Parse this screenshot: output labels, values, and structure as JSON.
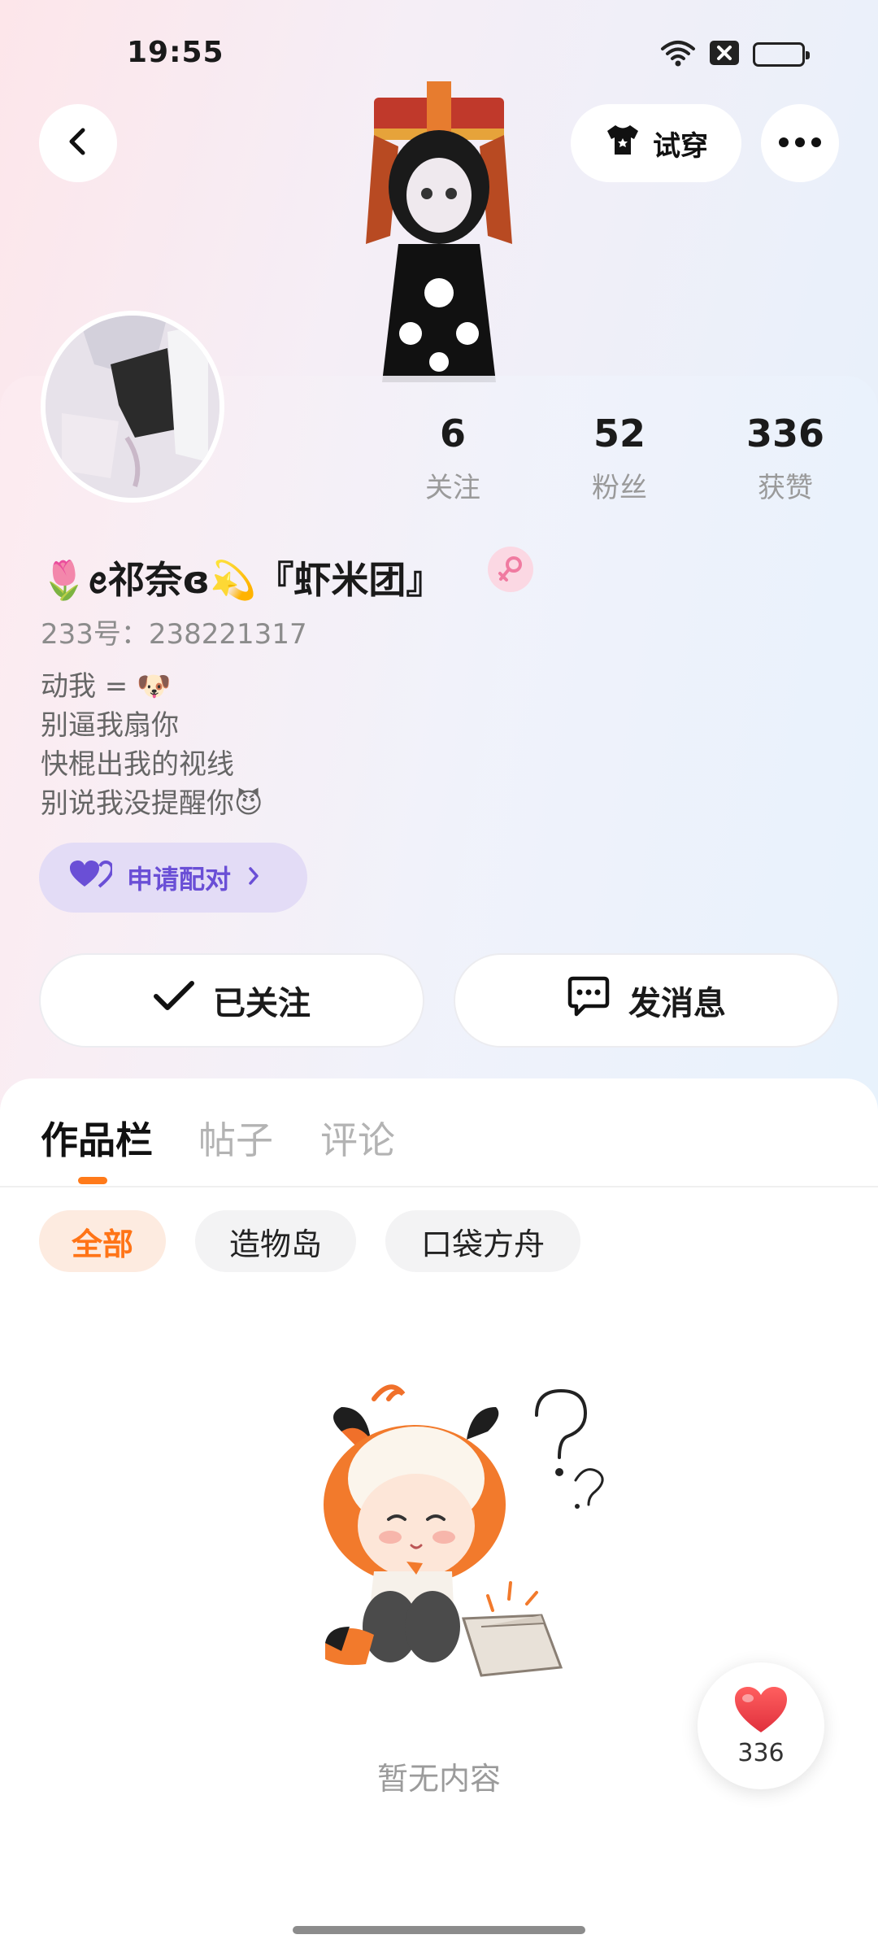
{
  "status_bar": {
    "time": "19:55",
    "icons": [
      "wifi-icon",
      "sim-off-icon",
      "battery-icon"
    ],
    "battery_color": "#f6c22b"
  },
  "header": {
    "back_icon": "chevron-left-icon",
    "tryon_label": "试穿",
    "tryon_icon": "tshirt-icon",
    "more_icon": "more-dots-icon"
  },
  "profile": {
    "stats": [
      {
        "value": "6",
        "label": "关注"
      },
      {
        "value": "52",
        "label": "粉丝"
      },
      {
        "value": "336",
        "label": "获赞"
      }
    ],
    "nickname": "🌷ꫀ祁奈ɞ💫『虾米团』",
    "gender_icon": "female-icon",
    "uid": "233号：238221317",
    "bio": [
      "动我 = 🐶",
      "别逼我扇你",
      "快棍出我的视线",
      "别说我没提醒你😈"
    ],
    "pair_label": "申请配对",
    "pair_color": "#6a4fd6"
  },
  "actions": {
    "follow_label": "已关注",
    "message_label": "发消息"
  },
  "tabs": [
    {
      "label": "作品栏",
      "active": true
    },
    {
      "label": "帖子",
      "active": false
    },
    {
      "label": "评论",
      "active": false
    }
  ],
  "chips": [
    {
      "label": "全部",
      "active": true
    },
    {
      "label": "造物岛",
      "active": false
    },
    {
      "label": "口袋方舟",
      "active": false
    }
  ],
  "accent_color": "#ff7a1a",
  "empty": {
    "text": "暂无内容",
    "illustration": "confused-girl-empty-box-illustration"
  },
  "like_fab": {
    "count": "336",
    "icon": "heart-icon",
    "color": "#f0424f"
  }
}
